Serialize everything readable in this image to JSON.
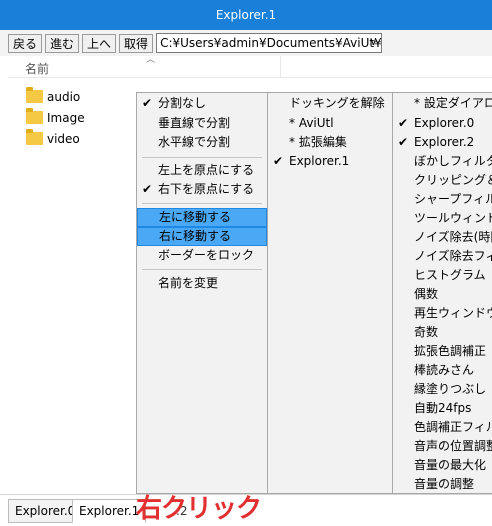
{
  "window": {
    "title": "Explorer.1"
  },
  "toolbar": {
    "back_label": "戻る",
    "forward_label": "進む",
    "up_label": "上へ",
    "get_label": "取得",
    "path": "C:¥Users¥admin¥Documents¥AviUt¥p"
  },
  "list": {
    "column_name": "名前",
    "items": [
      "audio",
      "Image",
      "video"
    ]
  },
  "context_menu": {
    "split": {
      "none": "分割なし",
      "vertical": "垂直線で分割",
      "horizontal": "水平線で分割"
    },
    "origin": {
      "top_left": "左上を原点にする",
      "bottom_right": "右下を原点にする"
    },
    "move": {
      "left": "左に移動する",
      "right": "右に移動する",
      "lock_border": "ボーダーをロック"
    },
    "rename": "名前を変更",
    "dock": {
      "undock": "ドッキングを解除",
      "aviutl": "* AviUtl",
      "ext_edit": "* 拡張編集",
      "explorer1": "Explorer.1"
    },
    "windows": [
      "* 設定ダイアログ",
      "Explorer.0",
      "Explorer.2",
      "ぼかしフィルタ",
      "クリッピング＆リサ",
      "シャープフィルタ",
      "ツールウィンドウ",
      "ノイズ除去(時間軸",
      "ノイズ除去フィルタ",
      "ヒストグラム",
      "偶数",
      "再生ウィンドウ",
      "奇数",
      "拡張色調補正",
      "棒読みさん",
      "縁塗りつぶし",
      "自動24fps",
      "色調補正フィルタ",
      "音声の位置調整",
      "音量の最大化",
      "音量の調整"
    ],
    "check_mark": "✔"
  },
  "statusbar": {
    "tab0": "Explorer.0",
    "tab1": "Explorer.1",
    "tab2_partial": ".2"
  },
  "annotation": "右クリック",
  "colors": {
    "titlebar": "#1a7fd8",
    "highlight": "#4aa8f4",
    "annotation": "#e23030"
  }
}
